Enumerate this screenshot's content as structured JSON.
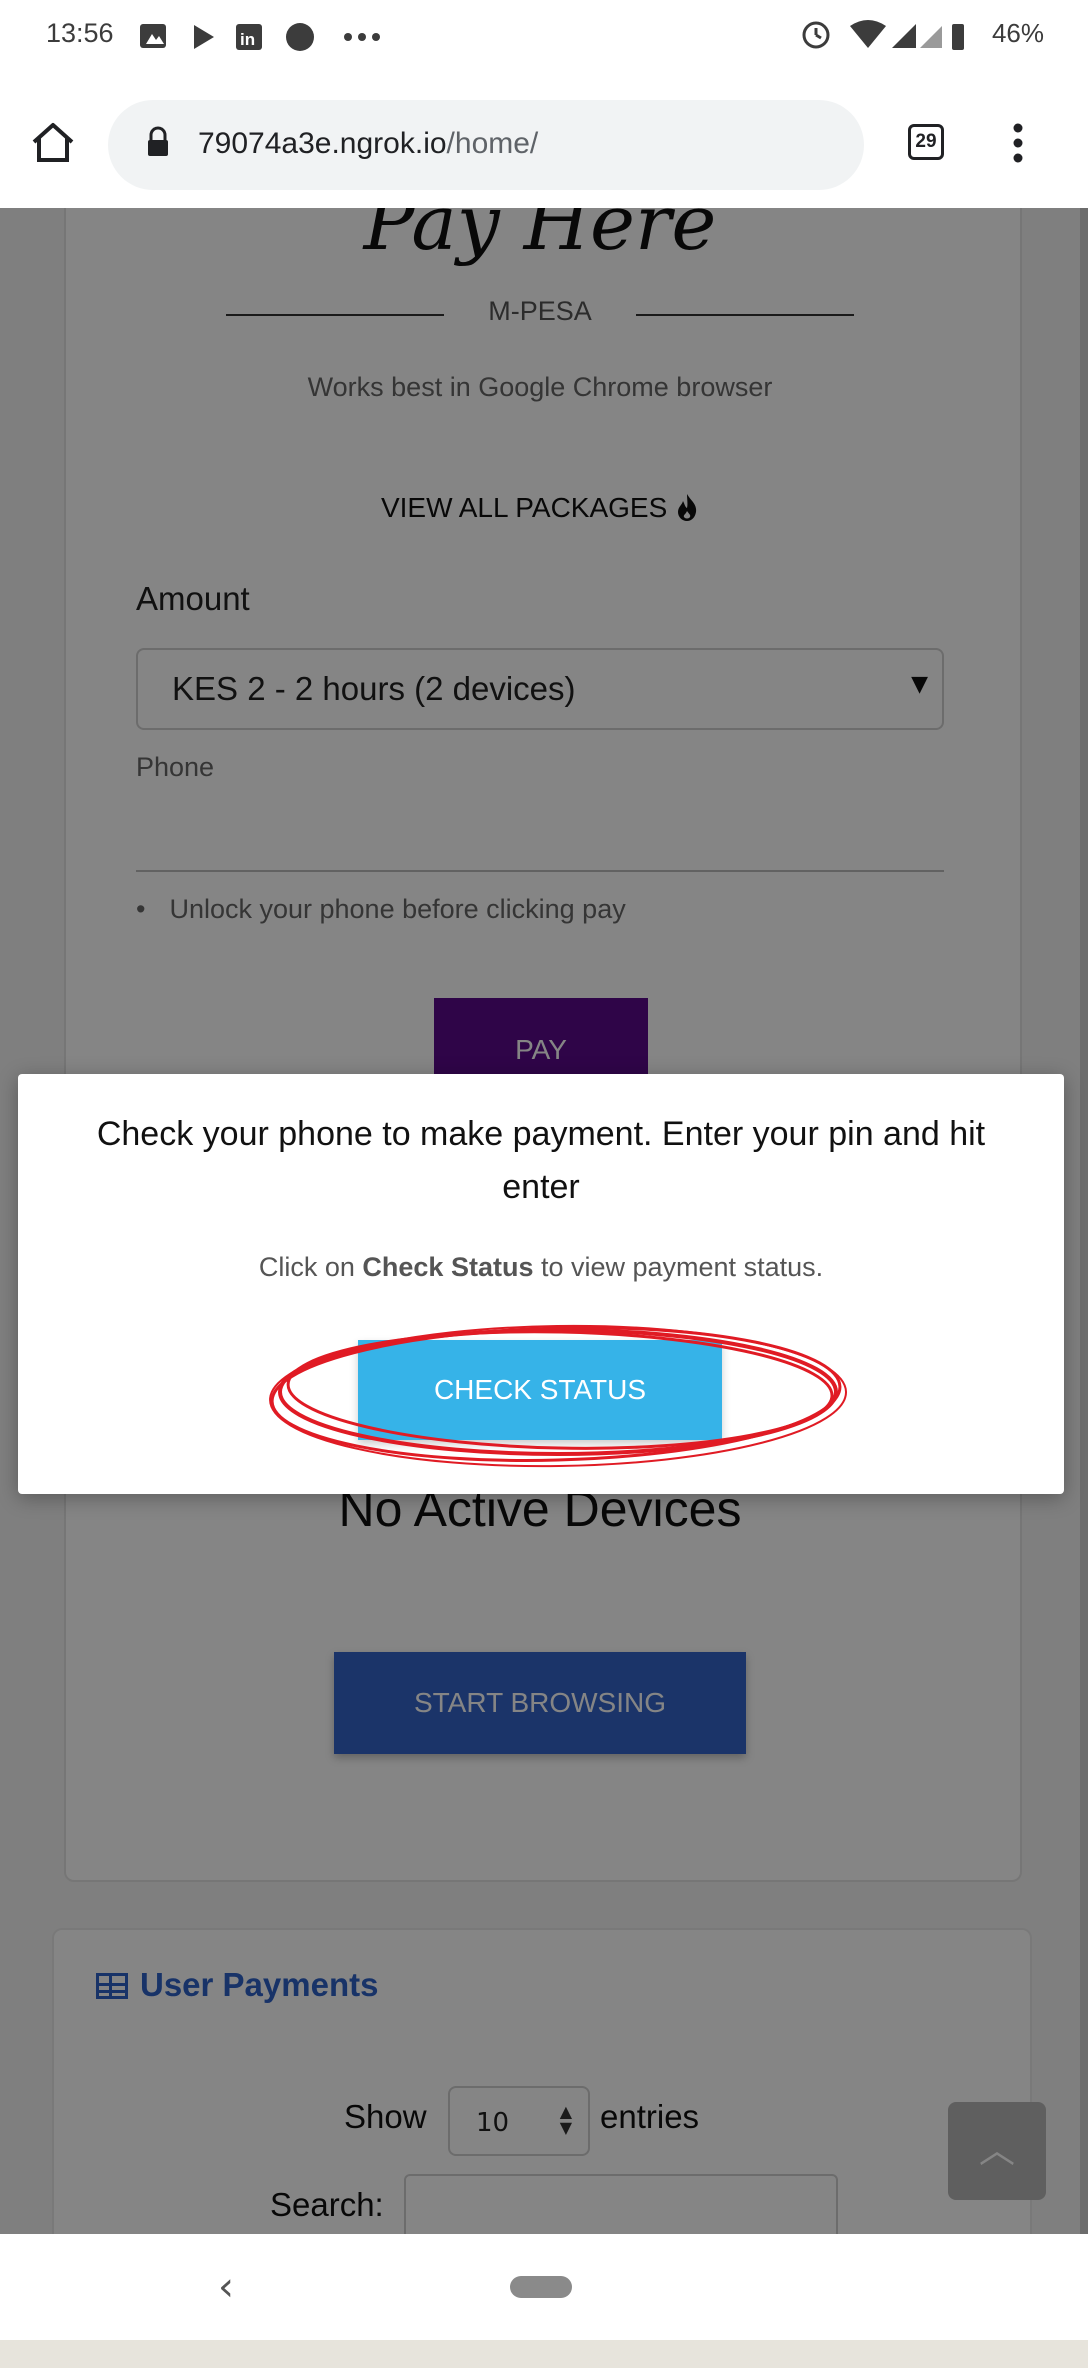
{
  "status_bar": {
    "time": "13:56",
    "battery": "46%",
    "icons": [
      "image-icon",
      "play-icon",
      "linkedin-icon",
      "circle-icon",
      "more-dots-icon",
      "alarm-icon",
      "wifi-icon",
      "signal-icon",
      "battery-icon"
    ]
  },
  "browser": {
    "url_host": "79074a3e.ngrok.io",
    "url_path": "/home/",
    "tab_count": "29"
  },
  "page": {
    "title": "Pay Here",
    "divider_label": "M-PESA",
    "browser_note": "Works best in Google Chrome browser",
    "view_all_packages": "VIEW ALL PACKAGES",
    "amount_label": "Amount",
    "amount_selected": "KES 2 - 2 hours (2 devices)",
    "phone_label": "Phone",
    "phone_value": "",
    "hint": "Unlock your phone before clicking pay",
    "pay_button": "PAY",
    "no_devices": "No Active Devices",
    "start_browsing_button": "START BROWSING",
    "user_payments_title": "User Payments",
    "show_label": "Show",
    "entries_selected": "10",
    "entries_label": "entries",
    "search_label": "Search:"
  },
  "modal": {
    "title": "Check your phone to make payment. Enter your pin and hit enter",
    "text_before": "Click on ",
    "text_bold": "Check Status",
    "text_after": " to view payment status.",
    "check_status_button": "CHECK STATUS",
    "highlight_color": "#e01b24"
  },
  "colors": {
    "pay_button": "#5a0a8a",
    "check_status_button": "#36b3e8",
    "start_browsing_button": "#3565c9",
    "link_blue": "#2f62c7"
  }
}
